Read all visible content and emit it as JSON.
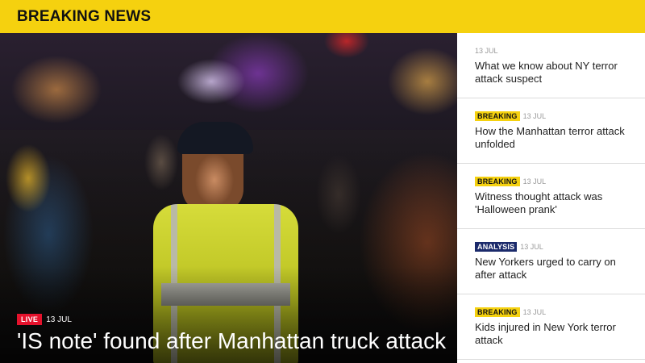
{
  "header": {
    "title": "BREAKING NEWS"
  },
  "hero": {
    "badge": "LIVE",
    "date": "13 JUL",
    "title": "'IS note' found after Manhattan truck attack"
  },
  "stories": [
    {
      "tag": "",
      "date": "13 JUL",
      "headline": "What we know about NY terror attack suspect"
    },
    {
      "tag": "BREAKING",
      "date": "13 JUL",
      "headline": "How the Manhattan terror attack unfolded"
    },
    {
      "tag": "BREAKING",
      "date": "13 JUL",
      "headline": "Witness thought attack was 'Halloween prank'"
    },
    {
      "tag": "ANALYSIS",
      "date": "13 JUL",
      "headline": "New Yorkers urged to carry on after attack"
    },
    {
      "tag": "BREAKING",
      "date": "13 JUL",
      "headline": "Kids injured in New York terror attack"
    }
  ],
  "colors": {
    "header_bg": "#f5d10f",
    "live_badge": "#e4122c",
    "breaking_tag_bg": "#f5d10f",
    "analysis_tag_bg": "#1b2a6b"
  }
}
